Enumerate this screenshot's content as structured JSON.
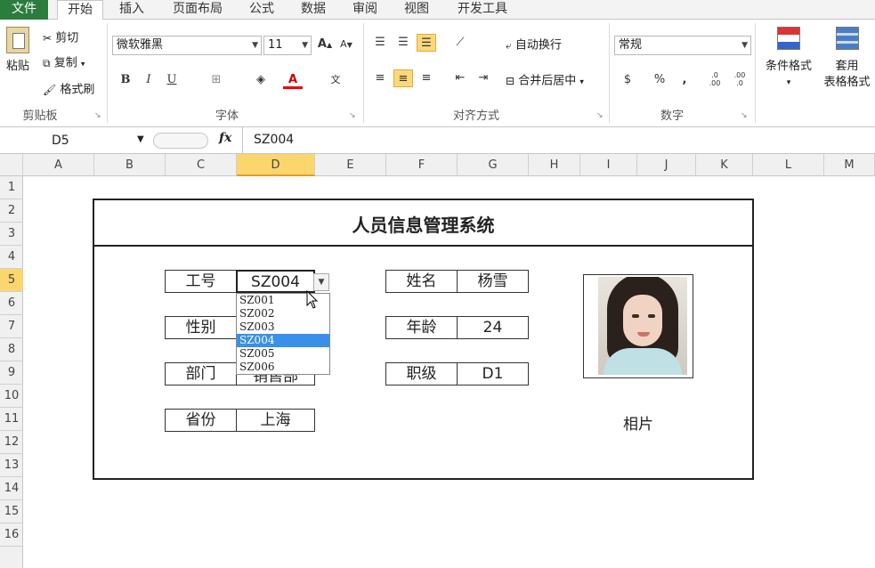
{
  "tabs": [
    "文件",
    "开始",
    "插入",
    "页面布局",
    "公式",
    "数据",
    "审阅",
    "视图",
    "开发工具"
  ],
  "ribbon": {
    "clipboard": {
      "paste": "粘贴",
      "cut": "剪切",
      "copy": "复制",
      "format_painter": "格式刷",
      "label": "剪贴板"
    },
    "font": {
      "name": "微软雅黑",
      "size": "11",
      "bold": "B",
      "italic": "I",
      "underline": "U",
      "label": "字体"
    },
    "align": {
      "wrap": "自动换行",
      "merge": "合并后居中",
      "label": "对齐方式"
    },
    "number": {
      "format": "常规",
      "percent": "%",
      "comma": ",",
      "inc_decimal": ".0 .00",
      "dec_decimal": ".00 .0",
      "label": "数字"
    },
    "styles": {
      "conditional": "条件格式",
      "table_fmt_1": "套用",
      "table_fmt_2": "表格格式"
    }
  },
  "formula_bar": {
    "name_box": "D5",
    "fx": "fx",
    "value": "SZ004"
  },
  "columns": [
    "A",
    "B",
    "C",
    "D",
    "E",
    "F",
    "G",
    "H",
    "I",
    "J",
    "K",
    "L",
    "M"
  ],
  "selected_column": "D",
  "rows": [
    "1",
    "2",
    "3",
    "4",
    "5",
    "6",
    "7",
    "8",
    "9",
    "10",
    "11",
    "12",
    "13",
    "14",
    "15",
    "16"
  ],
  "selected_row": "5",
  "form": {
    "title": "人员信息管理系统",
    "id_label": "工号",
    "id_value": "SZ004",
    "gender_label": "性别",
    "gender_value": "",
    "dept_label": "部门",
    "dept_value": "销售部",
    "province_label": "省份",
    "province_value": "上海",
    "name_label": "姓名",
    "name_value": "杨雪",
    "age_label": "年龄",
    "age_value": "24",
    "level_label": "职级",
    "level_value": "D1",
    "photo_label": "相片"
  },
  "dropdown": {
    "options": [
      "SZ001",
      "SZ002",
      "SZ003",
      "SZ004",
      "SZ005",
      "SZ006"
    ],
    "selected": "SZ004"
  },
  "colors": {
    "accent": "#2a7d3c",
    "selection": "#fbd56e",
    "highlight": "#3a90e8"
  }
}
